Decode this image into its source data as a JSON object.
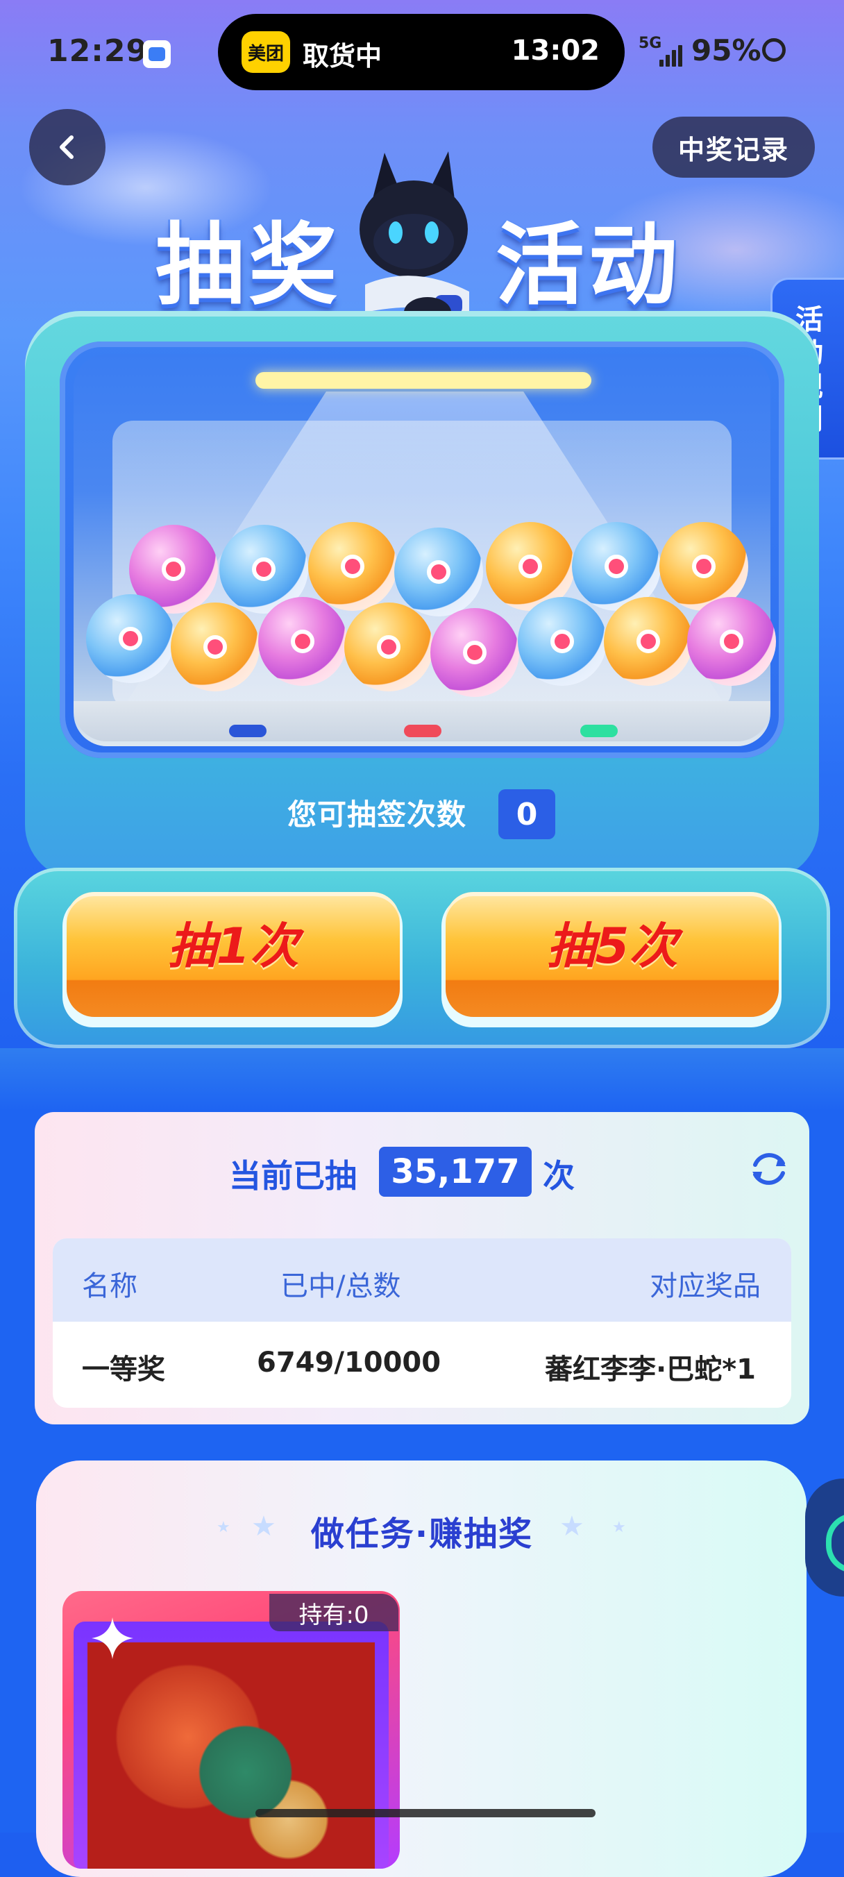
{
  "status_bar": {
    "time": "12:29",
    "island": {
      "app_badge": "美团",
      "status": "取货中",
      "eta": "13:02"
    },
    "network": "5G",
    "battery": "95%"
  },
  "header": {
    "records_label": "中奖记录",
    "rules_label": "活动规则"
  },
  "title": {
    "left": "抽奖",
    "right": "活动"
  },
  "machine": {
    "balls": [
      "pink",
      "blue",
      "orange",
      "blue",
      "orange",
      "blue",
      "orange",
      "blue",
      "orange",
      "pink",
      "orange",
      "pink",
      "blue",
      "orange",
      "pink"
    ],
    "led_colors": [
      "#2a55d8",
      "#f04a5a",
      "#2de0a0"
    ],
    "chance_label": "您可抽签次数",
    "chance_count": "0",
    "draw_once_label": "抽1次",
    "draw_five_label": "抽5次"
  },
  "stats": {
    "drawn_label": "当前已抽",
    "drawn_count": "35,177",
    "drawn_unit": "次",
    "columns": [
      "名称",
      "已中/总数",
      "对应奖品"
    ],
    "rows": [
      {
        "name": "一等奖",
        "progress": "6749/10000",
        "prize": "蕃红李李·巴蛇*1"
      }
    ]
  },
  "tasks": {
    "title": "做任务·赚抽奖",
    "card_holding": "持有:0"
  },
  "colors": {
    "accent_blue": "#2d5fe6",
    "button_orange": "#ffa520",
    "button_text_red": "#ec1a1a"
  }
}
